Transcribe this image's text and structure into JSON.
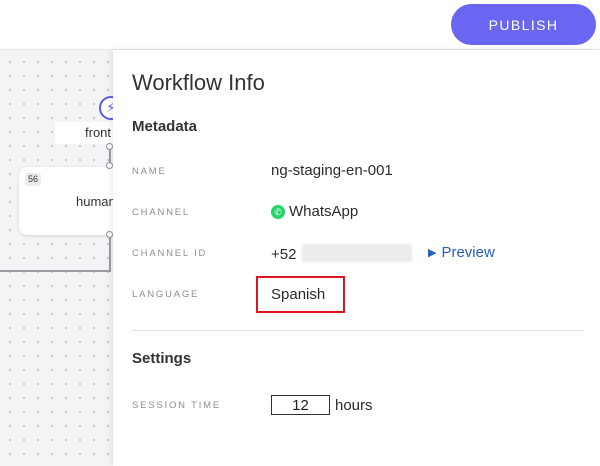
{
  "toolbar": {
    "publish_label": "PUBLISH"
  },
  "canvas": {
    "nodes": [
      {
        "label": "front"
      },
      {
        "badge": "56",
        "label": "human"
      }
    ]
  },
  "panel": {
    "title": "Workflow Info",
    "metadata": {
      "heading": "Metadata",
      "name_label": "NAME",
      "name_value": "ng-staging-en-001",
      "channel_label": "CHANNEL",
      "channel_value": "WhatsApp",
      "channel_icon": "whatsapp-icon",
      "channel_id_label": "CHANNEL ID",
      "channel_id_prefix": "+52",
      "preview_label": "Preview",
      "language_label": "LANGUAGE",
      "language_value": "Spanish"
    },
    "settings": {
      "heading": "Settings",
      "session_time_label": "SESSION TIME",
      "session_time_value": "12",
      "session_time_unit": "hours"
    }
  },
  "colors": {
    "accent": "#6b66f2",
    "link": "#2b5fbf",
    "highlight_box": "#e0141e",
    "whatsapp": "#25d366"
  }
}
